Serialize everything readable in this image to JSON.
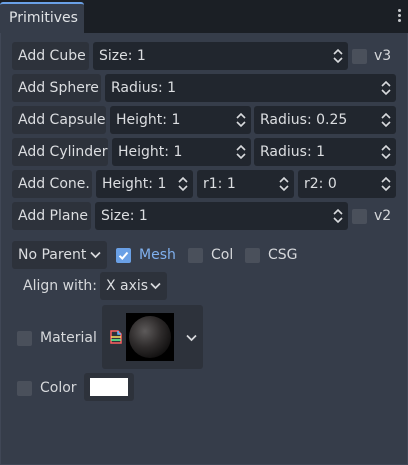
{
  "tab": {
    "title": "Primitives"
  },
  "cube": {
    "button": "Add Cube",
    "size": "Size: 1",
    "check_label": "v3"
  },
  "sphere": {
    "button": "Add Sphere",
    "radius": "Radius: 1"
  },
  "capsule": {
    "button": "Add Capsule",
    "height": "Height: 1",
    "radius": "Radius: 0.25"
  },
  "cylinder": {
    "button": "Add Cylinder",
    "height": "Height: 1",
    "radius": "Radius: 1"
  },
  "cone": {
    "button": "Add Cone.",
    "height": "Height: 1",
    "r1": "r1: 1",
    "r2": "r2: 0"
  },
  "plane": {
    "button": "Add Plane",
    "size": "Size: 1",
    "check_label": "v2"
  },
  "options": {
    "parent": "No Parent",
    "mesh_label": "Mesh",
    "mesh_checked": true,
    "col_label": "Col",
    "col_checked": false,
    "csg_label": "CSG",
    "csg_checked": false
  },
  "align": {
    "label": "Align with:",
    "value": "X axis"
  },
  "material": {
    "label": "Material",
    "checked": false
  },
  "color": {
    "label": "Color",
    "checked": false,
    "value": "#ffffff"
  },
  "colors": {
    "accent": "#6aa0e6",
    "panel": "#363d4a",
    "field": "#21262e",
    "button": "#2d323b"
  }
}
